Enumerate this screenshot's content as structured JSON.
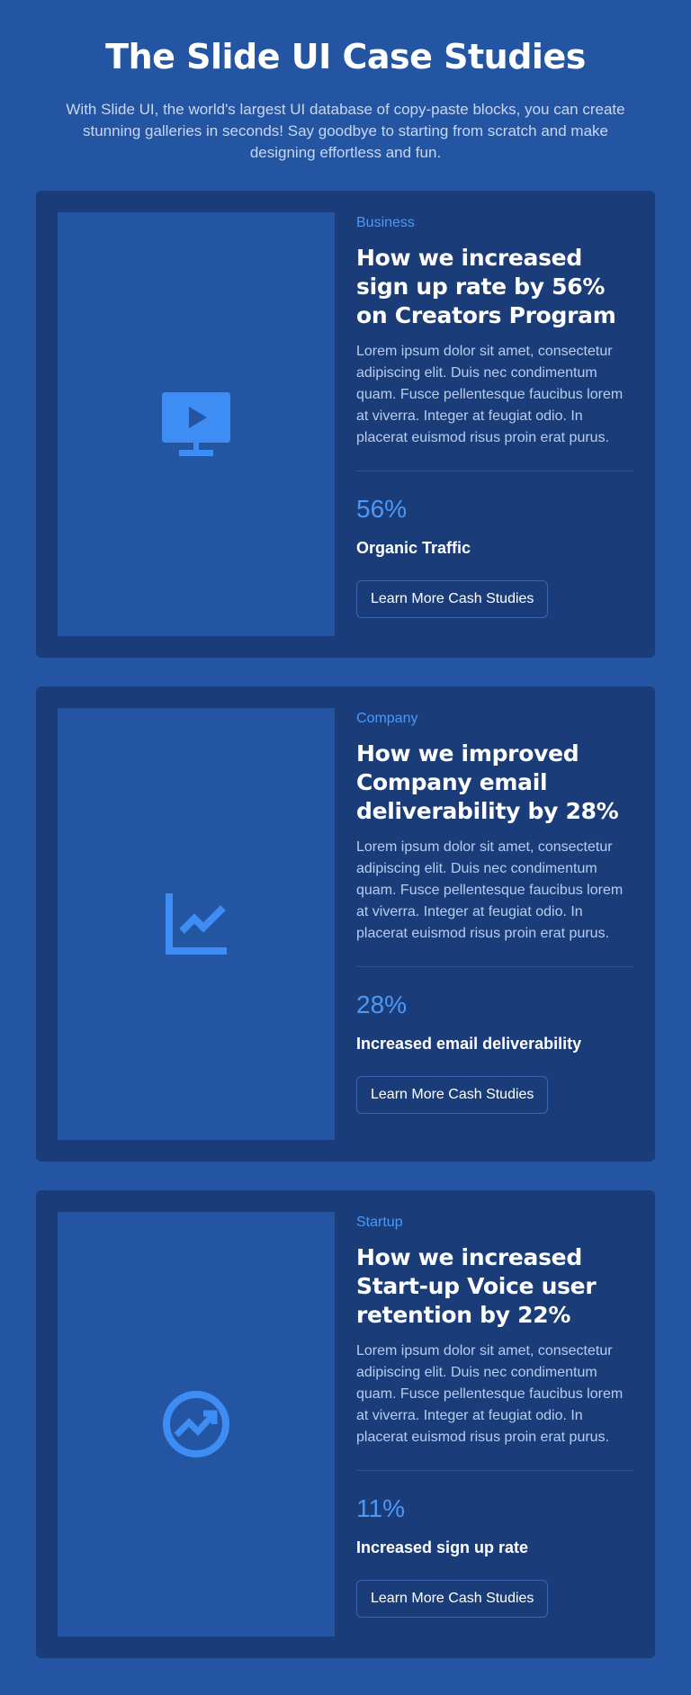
{
  "header": {
    "title": "The Slide UI Case Studies",
    "subtitle": "With Slide UI, the world's largest UI database of copy-paste blocks, you can create stunning galleries in seconds! Say goodbye to starting from scratch and make designing effortless and fun."
  },
  "colors": {
    "background": "#2355a3",
    "card": "#1a3d7a",
    "accent": "#4b98f6",
    "text": "#ffffff",
    "muted_text": "#b8ccef"
  },
  "cards": [
    {
      "icon": "monitor-play-icon",
      "category": "Business",
      "title": "How we increased sign up rate by 56% on Creators Program",
      "description": "Lorem ipsum dolor sit amet, consectetur adipiscing elit. Duis nec condimentum quam. Fusce pellentesque faucibus lorem at viverra. Integer at feugiat odio. In placerat euismod risus proin erat purus.",
      "stat_value": "56%",
      "stat_label": "Organic Traffic",
      "button_label": "Learn More Cash Studies"
    },
    {
      "icon": "line-chart-icon",
      "category": "Company",
      "title": "How we improved Company email deliverability by 28%",
      "description": "Lorem ipsum dolor sit amet, consectetur adipiscing elit. Duis nec condimentum quam. Fusce pellentesque faucibus lorem at viverra. Integer at feugiat odio. In placerat euismod risus proin erat purus.",
      "stat_value": "28%",
      "stat_label": "Increased email deliverability",
      "button_label": "Learn More Cash Studies"
    },
    {
      "icon": "trending-up-circle-icon",
      "category": "Startup",
      "title": "How we increased Start-up Voice user retention by 22%",
      "description": "Lorem ipsum dolor sit amet, consectetur adipiscing elit. Duis nec condimentum quam. Fusce pellentesque faucibus lorem at viverra. Integer at feugiat odio. In placerat euismod risus proin erat purus.",
      "stat_value": "11%",
      "stat_label": "Increased sign up rate",
      "button_label": "Learn More Cash Studies"
    }
  ]
}
